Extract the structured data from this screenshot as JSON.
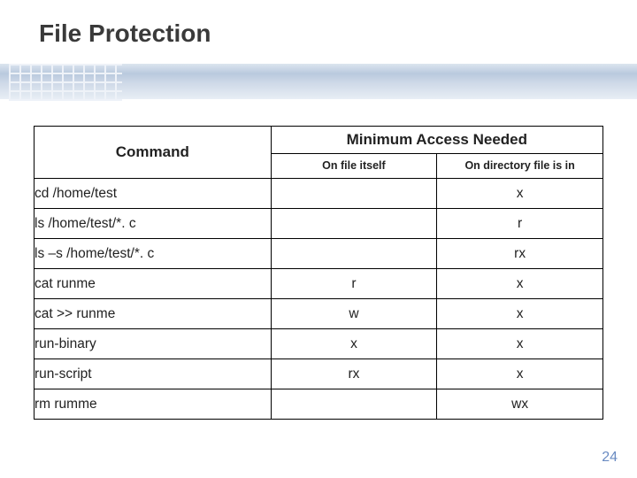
{
  "title": "File Protection",
  "page_number": "24",
  "table": {
    "header": {
      "command": "Command",
      "span": "Minimum Access Needed",
      "sub_a": "On file itself",
      "sub_b": "On directory file is in"
    },
    "rows": [
      {
        "cmd": "cd /home/test",
        "a": "",
        "b": "x"
      },
      {
        "cmd": "ls /home/test/*. c",
        "a": "",
        "b": "r"
      },
      {
        "cmd": "ls –s /home/test/*. c",
        "a": "",
        "b": "rx"
      },
      {
        "cmd": "cat runme",
        "a": "r",
        "b": "x"
      },
      {
        "cmd": "cat >> runme",
        "a": "w",
        "b": "x"
      },
      {
        "cmd": "run-binary",
        "a": "x",
        "b": "x"
      },
      {
        "cmd": "run-script",
        "a": "rx",
        "b": "x"
      },
      {
        "cmd": "rm rumme",
        "a": "",
        "b": "wx"
      }
    ]
  }
}
